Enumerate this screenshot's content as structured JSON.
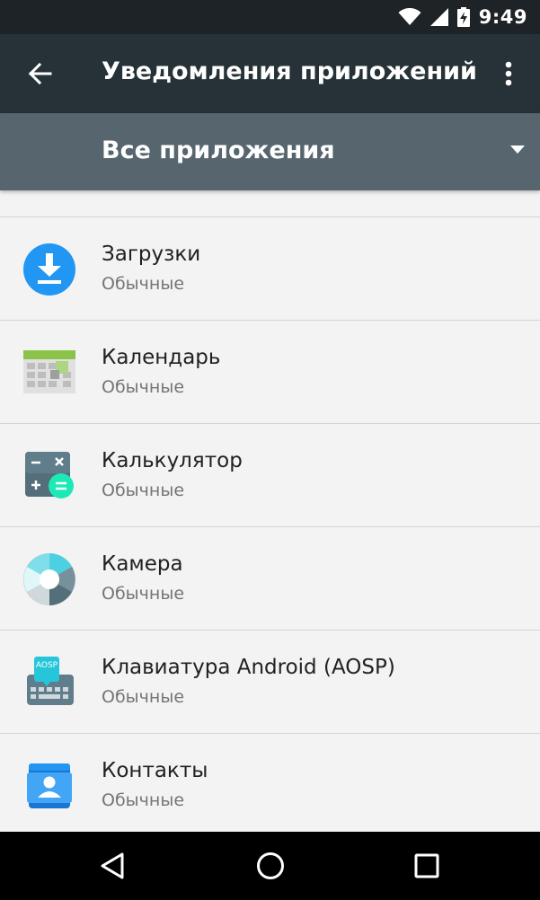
{
  "status_bar": {
    "time": "9:49",
    "icons": [
      "wifi-icon",
      "cell-signal-icon",
      "battery-charging-icon"
    ]
  },
  "toolbar": {
    "title": "Уведомления приложений",
    "back_icon": "arrow-back-icon",
    "menu_icon": "more-vert-icon"
  },
  "filter": {
    "selected": "Все приложения",
    "icon": "dropdown-caret-icon"
  },
  "apps": [
    {
      "name": "Загрузки",
      "status": "Обычные",
      "icon": "downloads-app-icon"
    },
    {
      "name": "Календарь",
      "status": "Обычные",
      "icon": "calendar-app-icon"
    },
    {
      "name": "Калькулятор",
      "status": "Обычные",
      "icon": "calculator-app-icon"
    },
    {
      "name": "Камера",
      "status": "Обычные",
      "icon": "camera-app-icon"
    },
    {
      "name": "Клавиатура Android (AOSP)",
      "status": "Обычные",
      "icon": "keyboard-app-icon"
    },
    {
      "name": "Контакты",
      "status": "Обычные",
      "icon": "contacts-app-icon"
    }
  ],
  "nav_bar": {
    "back": "nav-back-icon",
    "home": "nav-home-icon",
    "recents": "nav-recents-icon"
  },
  "colors": {
    "toolbar": "#263238",
    "filter_bar": "#56656e",
    "status_bar": "#1d2327",
    "background": "#f3f3f3"
  }
}
